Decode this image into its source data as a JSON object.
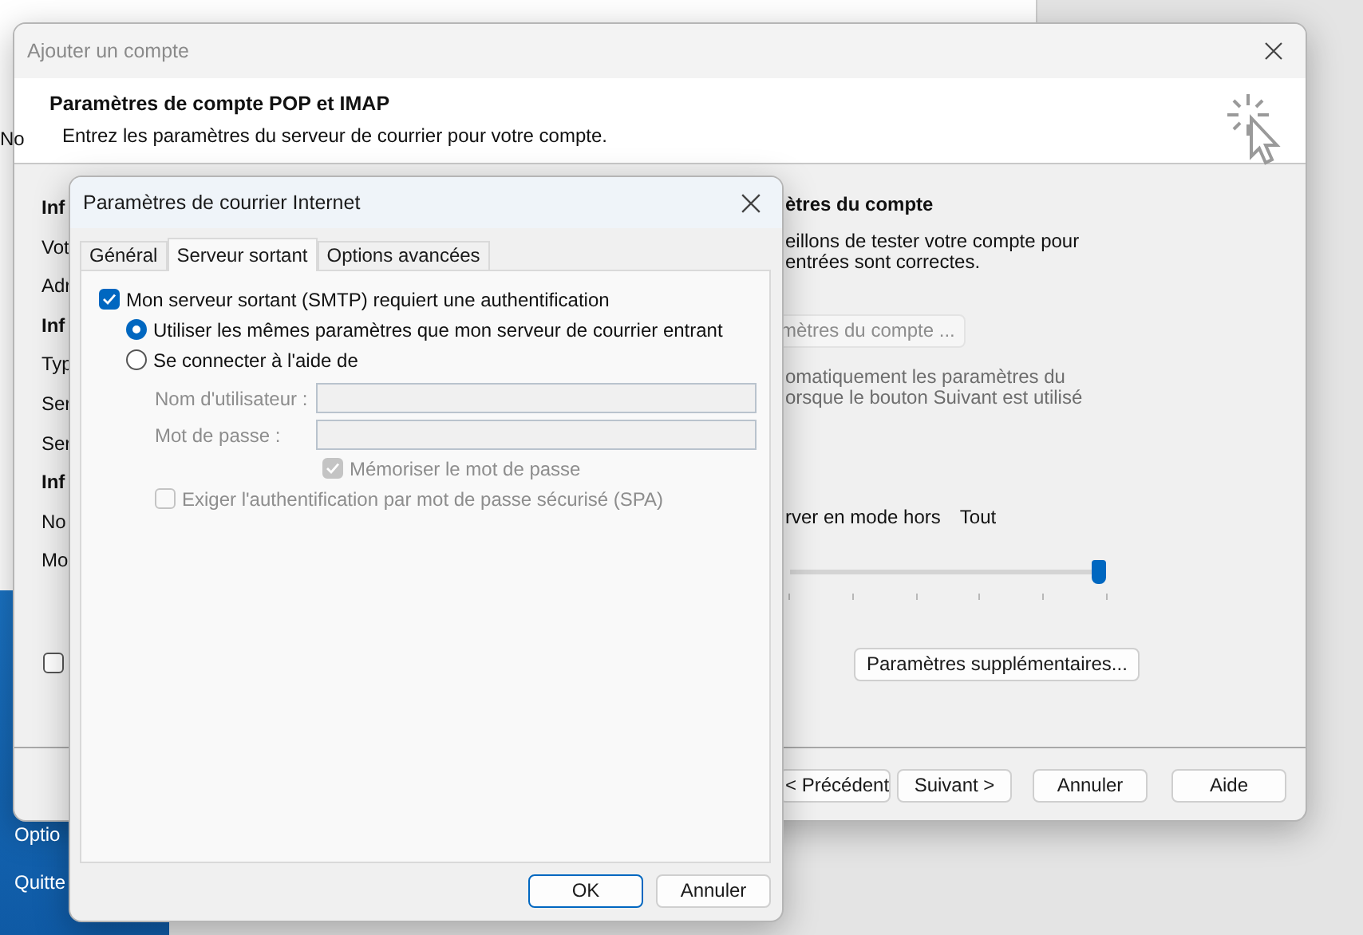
{
  "background_app": {
    "fragment": "No",
    "sidebar_items": [
      "Optio",
      "Quitte"
    ]
  },
  "account_dialog": {
    "title": "Ajouter un compte",
    "header_title": "Paramètres de compte POP et IMAP",
    "header_subtitle": "Entrez les paramètres du serveur de courrier pour votre compte.",
    "left_labels": [
      {
        "text": "Inf",
        "bold": true
      },
      {
        "text": "Vot",
        "bold": false
      },
      {
        "text": "Adr",
        "bold": false
      },
      {
        "text": "Inf",
        "bold": true
      },
      {
        "text": "Typ",
        "bold": false
      },
      {
        "text": "Ser",
        "bold": false
      },
      {
        "text": "Ser",
        "bold": false
      },
      {
        "text": "Inf",
        "bold": true
      },
      {
        "text": "No",
        "bold": false
      },
      {
        "text": "Mo",
        "bold": false
      }
    ],
    "left_checkbox": {
      "checked": false
    },
    "test_heading": "ètres du compte",
    "test_text": [
      "eillons de tester votre compte pour",
      "entrées sont correctes."
    ],
    "test_button": {
      "label": "mètres du compte ...",
      "disabled": true
    },
    "auto_text": [
      "omatiquement les paramètres du",
      "orsque le bouton Suivant est utilisé"
    ],
    "offline_label": "rver en mode hors",
    "offline_value": "Tout",
    "offline_slider": {
      "level": 1
    },
    "more_settings_button": "Paramètres supplémentaires...",
    "footer_buttons": [
      "< Précédent",
      "Suivant >",
      "Annuler",
      "Aide"
    ]
  },
  "internet_dialog": {
    "title": "Paramètres de courrier Internet",
    "tabs": [
      {
        "label": "Général",
        "selected": false
      },
      {
        "label": "Serveur sortant",
        "selected": true
      },
      {
        "label": "Options avancées",
        "selected": false
      }
    ],
    "require_auth": {
      "label": "Mon serveur sortant (SMTP) requiert une authentification",
      "checked": true
    },
    "auth_options": [
      {
        "label": "Utiliser les mêmes paramètres que mon serveur de courrier entrant",
        "selected": true
      },
      {
        "label": "Se connecter à l'aide de",
        "selected": false
      }
    ],
    "fields": [
      {
        "label": "Nom d'utilisateur :",
        "disabled": true
      },
      {
        "label": "Mot de passe :",
        "disabled": true
      }
    ],
    "remember_password": {
      "label": "Mémoriser le mot de passe",
      "checked": true,
      "disabled": true
    },
    "spa": {
      "label": "Exiger l'authentification par mot de passe sécurisé (SPA)",
      "checked": false,
      "disabled": true
    },
    "buttons": [
      {
        "label": "OK",
        "default": true
      },
      {
        "label": "Annuler",
        "default": false
      }
    ]
  }
}
